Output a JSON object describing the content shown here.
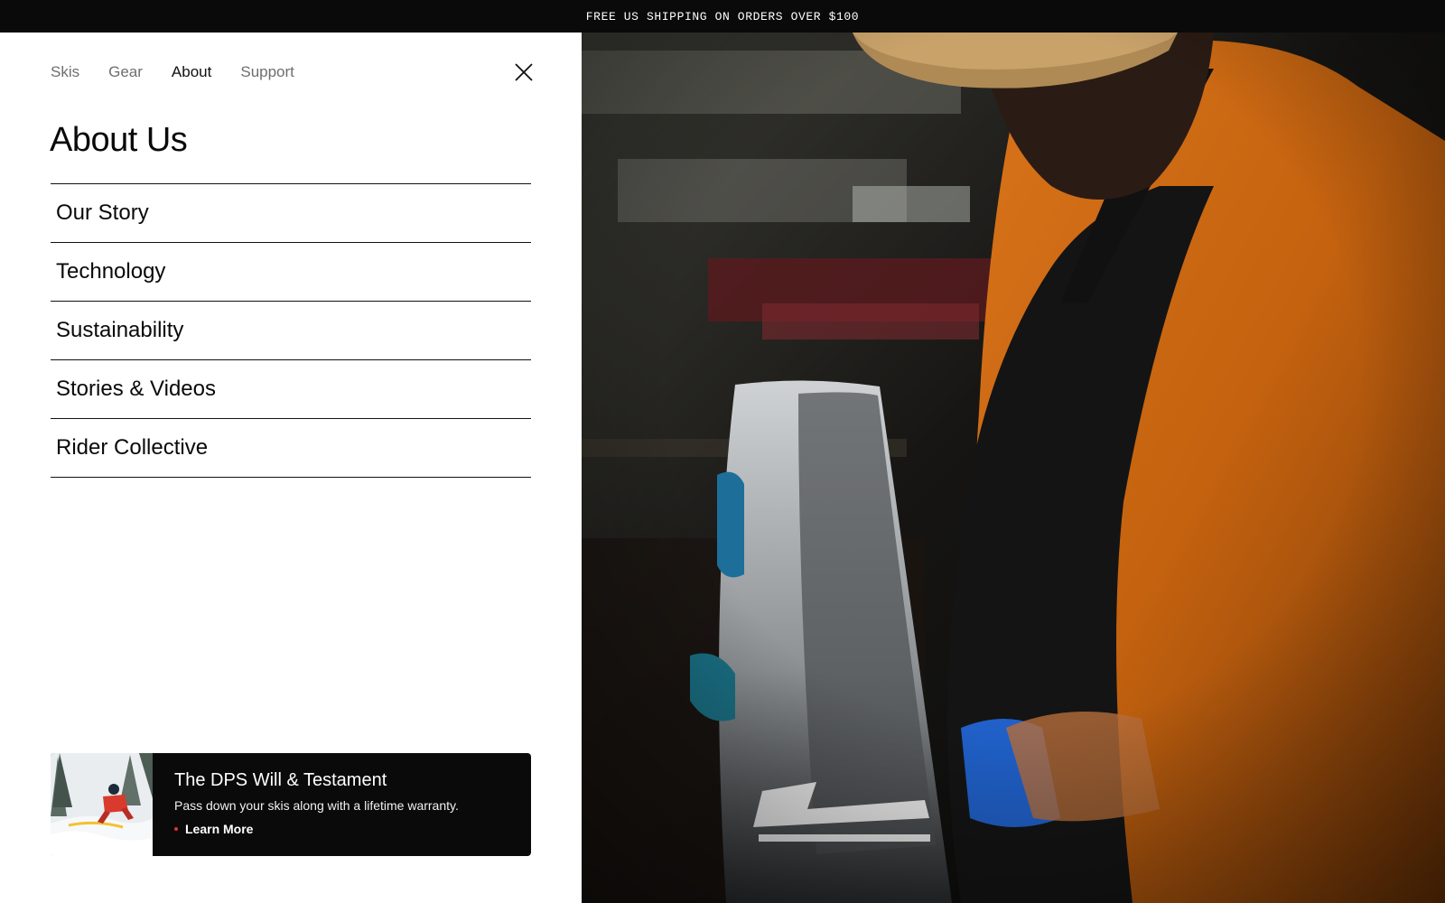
{
  "promo_bar": {
    "text": "FREE US SHIPPING ON ORDERS OVER $100"
  },
  "top_nav": {
    "items": [
      {
        "label": "Skis",
        "active": false
      },
      {
        "label": "Gear",
        "active": false
      },
      {
        "label": "About",
        "active": true
      },
      {
        "label": "Support",
        "active": false
      }
    ]
  },
  "close_icon": "close-icon",
  "section": {
    "title": "About Us",
    "items": [
      {
        "label": "Our Story"
      },
      {
        "label": "Technology"
      },
      {
        "label": "Sustainability"
      },
      {
        "label": "Stories & Videos"
      },
      {
        "label": "Rider Collective"
      }
    ]
  },
  "promo_card": {
    "title": "The DPS Will & Testament",
    "description": "Pass down your skis along with a lifetime warranty.",
    "link_label": "Learn More"
  },
  "colors": {
    "bar_background": "#0a0a0a",
    "card_background": "#0a0a0a",
    "link_dot": "#e5322d",
    "nav_inactive": "#6e6e6e",
    "text": "#111111"
  }
}
